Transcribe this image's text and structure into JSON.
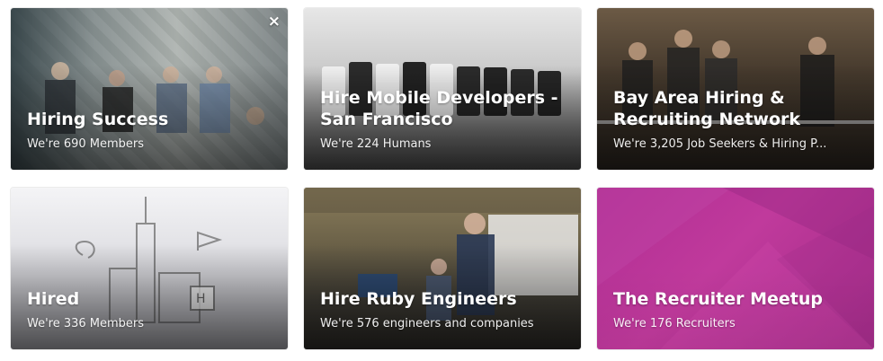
{
  "close_label": "×",
  "cards": [
    {
      "title": "Hiring Success",
      "subtitle": "We're 690 Members"
    },
    {
      "title": "Hire Mobile Developers - San Francisco",
      "subtitle": "We're 224 Humans"
    },
    {
      "title": "Bay Area Hiring & Recruiting Network",
      "subtitle": "We're 3,205 Job Seekers & Hiring P..."
    },
    {
      "title": "Hired",
      "subtitle": "We're 336 Members"
    },
    {
      "title": "Hire Ruby Engineers",
      "subtitle": "We're 576 engineers and companies"
    },
    {
      "title": "The Recruiter Meetup",
      "subtitle": "We're 176 Recruiters"
    }
  ],
  "colors": {
    "recruiter_card": "#b02d93"
  },
  "icons": {
    "close": "close-icon"
  }
}
